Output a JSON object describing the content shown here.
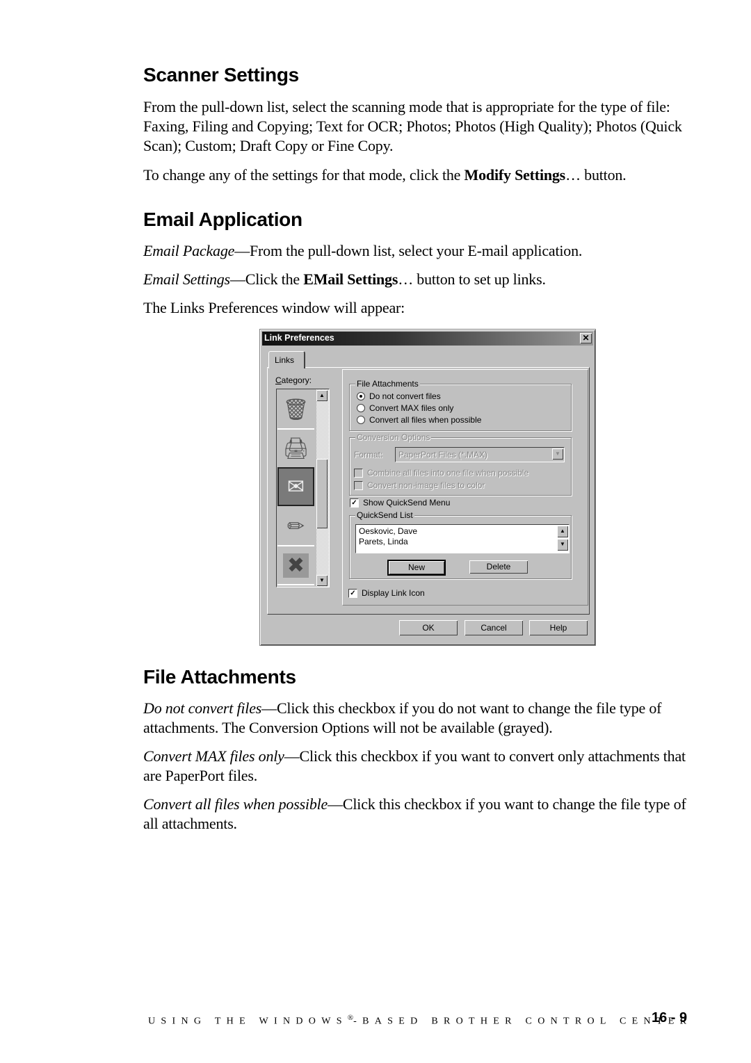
{
  "sections": {
    "scanner": {
      "heading": "Scanner Settings",
      "para1": "From the pull-down list, select the scanning mode that is appropriate for the type of file: Faxing, Filing and Copying; Text for OCR; Photos; Photos (High Quality); Photos (Quick Scan); Custom; Draft Copy or Fine Copy.",
      "para2_prefix": "To change any of the settings for that mode, click the ",
      "para2_bold": "Modify Settings",
      "para2_suffix": "… button."
    },
    "email": {
      "heading": "Email Application",
      "pkg_term": "Email Package",
      "pkg_text": "—From the pull-down list, select your E-mail application.",
      "settings_term": "Email Settings",
      "settings_prefix": "—Click the ",
      "settings_bold": "EMail Settings",
      "settings_suffix": "… button to set up links.",
      "intro": "The Links Preferences window will appear:"
    },
    "attachments": {
      "heading": "File Attachments",
      "items": [
        {
          "term": "Do not convert files",
          "text": "—Click this checkbox if you do not want to change the file type of attachments. The Conversion Options will not be available (grayed)."
        },
        {
          "term": "Convert MAX files only",
          "text": "—Click this checkbox if you want to convert only attachments that are PaperPort files."
        },
        {
          "term": "Convert all files when possible",
          "text": "—Click this checkbox if you want to change the file type of all attachments."
        }
      ]
    }
  },
  "dialog": {
    "title": "Link Preferences",
    "close_glyph": "✕",
    "tab": "Links",
    "category_label": "Category:",
    "categories": [
      {
        "name": "recycle-bin",
        "glyph": "🗑",
        "selected": false
      },
      {
        "name": "printer",
        "glyph": "🖨",
        "selected": false
      },
      {
        "name": "email",
        "glyph": "✉",
        "selected": true
      },
      {
        "name": "pencil-cup",
        "glyph": "✏",
        "selected": false
      },
      {
        "name": "excel",
        "glyph": "✖",
        "selected": false
      }
    ],
    "file_attachments": {
      "legend": "File Attachments",
      "options": [
        {
          "label": "Do not convert files",
          "selected": true
        },
        {
          "label": "Convert MAX files only",
          "selected": false
        },
        {
          "label": "Convert all files when possible",
          "selected": false
        }
      ]
    },
    "conversion": {
      "legend": "Conversion Options",
      "format_label": "Format:",
      "format_value": "PaperPort Files (*.MAX)",
      "combine_label": "Combine all files into one file when possible",
      "color_label": "Convert non-image files to color",
      "enabled": false
    },
    "show_quicksend": {
      "label": "Show QuickSend Menu",
      "checked": true
    },
    "quicksend": {
      "legend": "QuickSend List",
      "entries": [
        "Oeskovic, Dave",
        "Parets, Linda"
      ],
      "new_button": "New",
      "delete_button": "Delete"
    },
    "display_link_icon": {
      "label": "Display Link Icon",
      "checked": true
    },
    "buttons": {
      "ok": "OK",
      "cancel": "Cancel",
      "help": "Help"
    }
  },
  "footer": {
    "text_before": "USING THE WINDOWS",
    "registered": "®",
    "text_after": "-BASED BROTHER CONTROL CENTER",
    "page": "16 - 9"
  }
}
